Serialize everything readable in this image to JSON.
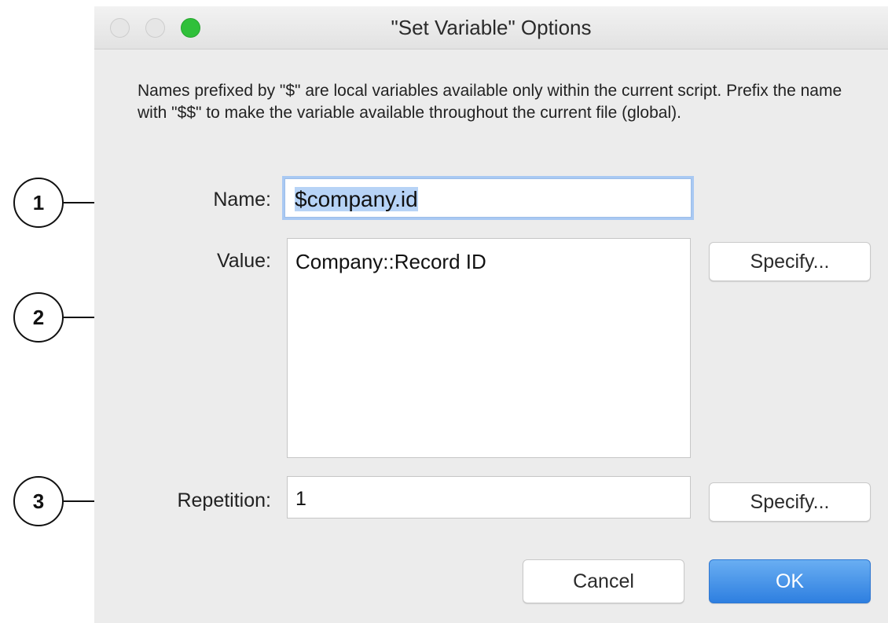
{
  "window": {
    "title": "\"Set Variable\" Options"
  },
  "description": "Names prefixed by \"$\" are local variables available only within the current script. Prefix the name with \"$$\" to make the variable available throughout the current file (global).",
  "fields": {
    "name_label": "Name:",
    "name_value": "$company.id",
    "value_label": "Value:",
    "value_text": "Company::Record ID",
    "repetition_label": "Repetition:",
    "repetition_value": "1"
  },
  "buttons": {
    "specify_value": "Specify...",
    "specify_repetition": "Specify...",
    "cancel": "Cancel",
    "ok": "OK"
  },
  "callouts": [
    "1",
    "2",
    "3"
  ],
  "colors": {
    "accent": "#2e7fe0",
    "zoom_button": "#30c03a",
    "focus_ring": "#a9c9f3"
  }
}
